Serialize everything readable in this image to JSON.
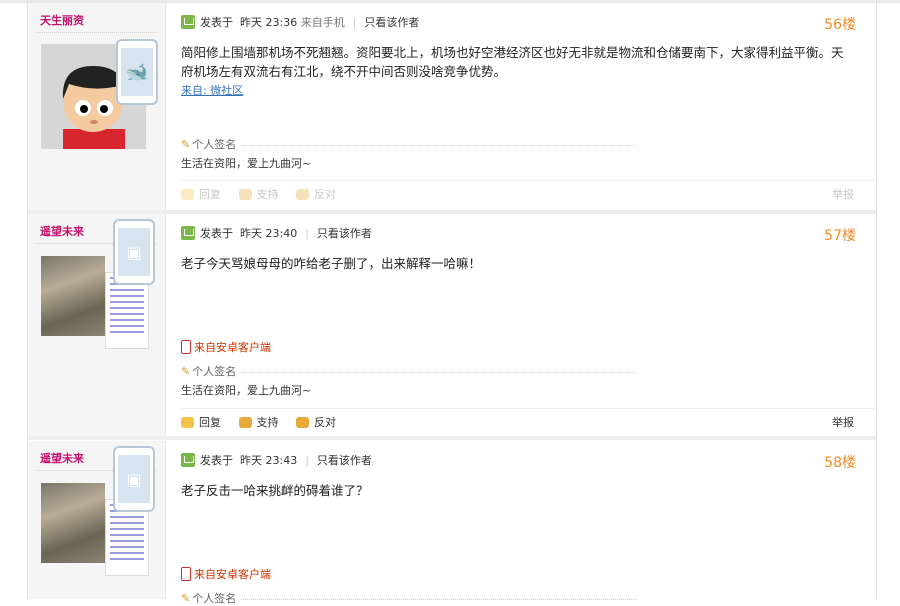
{
  "posts": [
    {
      "username": "天生丽资",
      "meta_prefix": "发表于",
      "time": "昨天 23:36",
      "source_device": "来自手机",
      "only_author": "只看该作者",
      "floor": "56楼",
      "content": "简阳修上围墙那机场不死翘翘。资阳要北上，机场也好空港经济区也好无非就是物流和仓储要南下，大家得利益平衡。天府机场左有双流右有江北，绕不开中间否则没啥竞争优势。",
      "from_label": "来自: 微社区",
      "signature_label": "个人签名",
      "signature_text": "生活在资阳，爱上九曲河~",
      "actions": {
        "reply": "回复",
        "support": "支持",
        "oppose": "反对",
        "report": "举报"
      }
    },
    {
      "username": "遥望未来",
      "meta_prefix": "发表于",
      "time": "昨天 23:40",
      "only_author": "只看该作者",
      "floor": "57楼",
      "content": "老子今天骂娘母母的咋给老子删了，出来解释一哈嘛！",
      "client": "来自安卓客户端",
      "signature_label": "个人签名",
      "signature_text": "生活在资阳，爱上九曲河~",
      "actions": {
        "reply": "回复",
        "support": "支持",
        "oppose": "反对",
        "report": "举报"
      }
    },
    {
      "username": "遥望未来",
      "meta_prefix": "发表于",
      "time": "昨天 23:43",
      "only_author": "只看该作者",
      "floor": "58楼",
      "content": "老子反击一哈来挑衅的碍着谁了？",
      "client": "来自安卓客户端",
      "signature_label": "个人签名"
    }
  ],
  "colors": {
    "username": "#c4116e",
    "floor": "#f08b28",
    "client": "#cc3300",
    "link": "#3470b8"
  },
  "icons": [
    "post-icon",
    "whale-icon",
    "android-icon",
    "phone-icon",
    "pencil-icon",
    "reply-icon",
    "thumbs-up-icon",
    "thumbs-down-icon"
  ]
}
